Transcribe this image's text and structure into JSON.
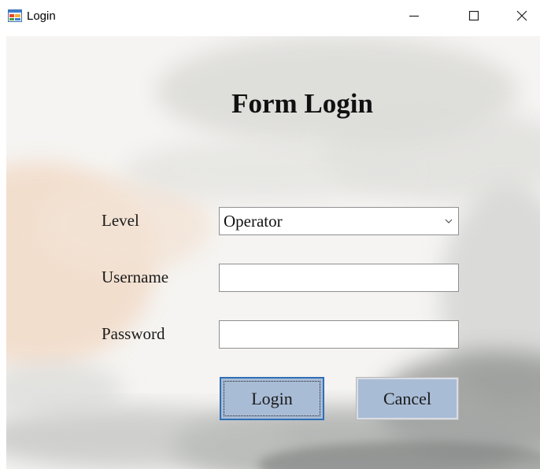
{
  "window": {
    "title": "Login",
    "icon": "form-window-icon",
    "controls": {
      "minimize_icon": "minimize-icon",
      "maximize_icon": "maximize-icon",
      "close_icon": "close-icon"
    }
  },
  "form": {
    "heading": "Form Login",
    "level": {
      "label": "Level",
      "selected": "Operator",
      "dropdown_icon": "chevron-down-icon"
    },
    "username": {
      "label": "Username",
      "value": ""
    },
    "password": {
      "label": "Password",
      "value": ""
    },
    "buttons": {
      "login": "Login",
      "cancel": "Cancel"
    }
  },
  "colors": {
    "button_fill": "#a9bcd6",
    "focus_border": "#2f6fb4",
    "field_border": "#8f8f8f"
  }
}
